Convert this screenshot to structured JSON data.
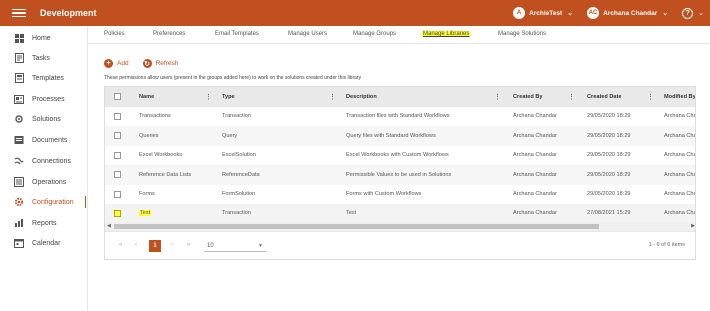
{
  "app": {
    "title": "Development"
  },
  "topbar": {
    "workspace": {
      "initial": "A",
      "name": "ArchieTest"
    },
    "user": {
      "initials": "AC",
      "name": "Archana Chandar"
    },
    "help_glyph": "?"
  },
  "sidebar": {
    "items": [
      {
        "label": "Home",
        "icon": "home-icon"
      },
      {
        "label": "Tasks",
        "icon": "tasks-icon"
      },
      {
        "label": "Templates",
        "icon": "templates-icon"
      },
      {
        "label": "Processes",
        "icon": "processes-icon"
      },
      {
        "label": "Solutions",
        "icon": "solutions-icon"
      },
      {
        "label": "Documents",
        "icon": "documents-icon"
      },
      {
        "label": "Connections",
        "icon": "connections-icon"
      },
      {
        "label": "Operations",
        "icon": "operations-icon"
      },
      {
        "label": "Configuration",
        "icon": "gear-icon",
        "active": true
      },
      {
        "label": "Reports",
        "icon": "reports-icon"
      },
      {
        "label": "Calendar",
        "icon": "calendar-icon"
      }
    ]
  },
  "tabs": [
    {
      "label": "Policies"
    },
    {
      "label": "Preferences"
    },
    {
      "label": "Email Templates"
    },
    {
      "label": "Manage Users"
    },
    {
      "label": "Manage Groups"
    },
    {
      "label": "Manage Libraries",
      "active": true
    },
    {
      "label": "Manage Solutions"
    }
  ],
  "toolbar": {
    "add_label": "Add",
    "refresh_label": "Refresh"
  },
  "description": "These permissions allow users (present in the groups added here) to work on the solutions created under this library",
  "table": {
    "columns": [
      "Name",
      "Type",
      "Description",
      "Created By",
      "Created Date",
      "Modified By"
    ],
    "rows": [
      [
        "Transactions",
        "Transaction",
        "Transaction files with Standard Workflows",
        "Archana Chandar",
        "29/05/2020 18:29",
        "Archana Cha"
      ],
      [
        "Queries",
        "Query",
        "Query files with Standard Workflows",
        "Archana Chandar",
        "29/05/2020 18:29",
        "Archana Cha"
      ],
      [
        "Excel Workbooks",
        "ExcelSolution",
        "Excel Workbooks with Custom Workflows",
        "Archana Chandar",
        "29/05/2020 18:29",
        "Archana Cha"
      ],
      [
        "Reference Data Lists",
        "ReferenceData",
        "Permissible Values to be used in Solutions",
        "Archana Chandar",
        "29/05/2020 18:29",
        "Archana Cha"
      ],
      [
        "Forms",
        "FormSolution",
        "Forms with Custom Workflows",
        "Archana Chandar",
        "29/05/2020 18:29",
        "Archana Cha"
      ],
      [
        "Test",
        "Transaction",
        "Test",
        "Archana Chandar",
        "27/08/2021 15:29",
        "Archana Cha"
      ]
    ]
  },
  "pager": {
    "first": "«",
    "prev": "‹",
    "current_page": "1",
    "next": "›",
    "last": "»",
    "page_size": "10",
    "info": "1 - 6 of 6 items"
  }
}
